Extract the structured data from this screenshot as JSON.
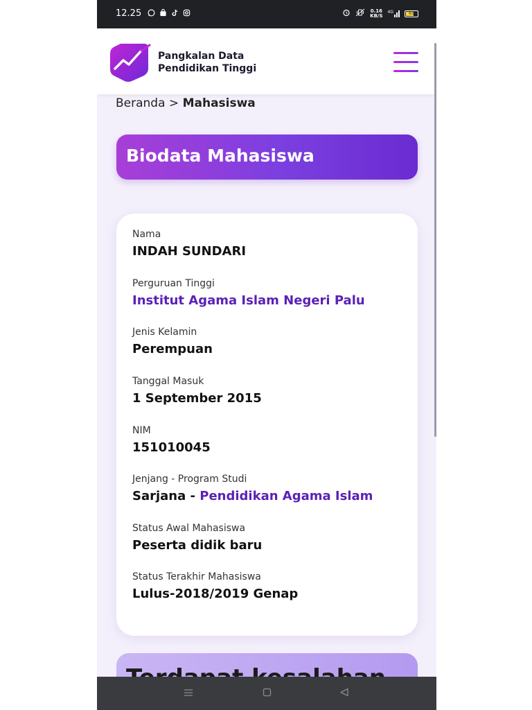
{
  "status_bar": {
    "time": "12.25",
    "left_icons": [
      "whatsapp-icon",
      "bag-icon",
      "tiktok-icon",
      "instagram-icon"
    ],
    "net_speed_value": "0.16",
    "net_speed_unit": "KB/S",
    "network": "4G",
    "battery": "65"
  },
  "header": {
    "brand_line1": "Pangkalan Data",
    "brand_line2": "Pendidikan Tinggi"
  },
  "breadcrumb": {
    "home": "Beranda",
    "separator": ">",
    "current": "Mahasiswa"
  },
  "title_card": {
    "title": "Biodata Mahasiswa"
  },
  "biodata": {
    "nama_label": "Nama",
    "nama_value": "INDAH SUNDARI",
    "pt_label": "Perguruan Tinggi",
    "pt_value": "Institut Agama Islam Negeri Palu",
    "jk_label": "Jenis Kelamin",
    "jk_value": "Perempuan",
    "tgl_label": "Tanggal Masuk",
    "tgl_value": "1 September 2015",
    "nim_label": "NIM",
    "nim_value": "151010045",
    "prodi_label": "Jenjang - Program Studi",
    "jenjang_value": "Sarjana",
    "prodi_separator": " - ",
    "prodi_value": "Pendidikan Agama Islam",
    "status_awal_label": "Status Awal Mahasiswa",
    "status_awal_value": "Peserta didik baru",
    "status_akhir_label": "Status Terakhir Mahasiswa",
    "status_akhir_value": "Lulus-2018/2019 Genap"
  },
  "next_card": {
    "title": "Terdapat kesalahan"
  },
  "colors": {
    "accent": "#5b21b6",
    "gradient_start": "#a83ed8",
    "gradient_end": "#6a2bd0",
    "page_bg": "#f4f0fb"
  }
}
